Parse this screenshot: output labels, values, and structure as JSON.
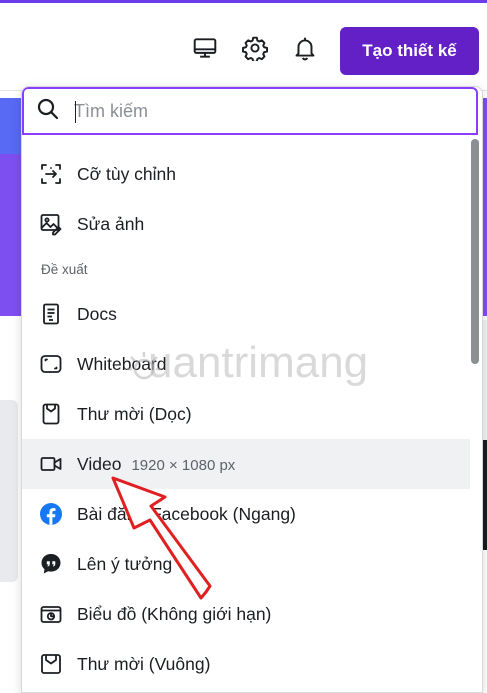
{
  "header": {
    "desktop_icon": "monitor-icon",
    "settings_icon": "gear-icon",
    "notifications_icon": "bell-icon",
    "create_button_label": "Tạo thiết kế",
    "accent_color": "#6420c7"
  },
  "search": {
    "placeholder": "Tìm kiếm",
    "value": "",
    "icon": "search-icon",
    "focus_color": "#8b3dff"
  },
  "menu": {
    "top_items": [
      {
        "label": "Cỡ tùy chỉnh",
        "icon": "custom-size-icon"
      },
      {
        "label": "Sửa ảnh",
        "icon": "image-edit-icon"
      }
    ],
    "section_label": "Đề xuất",
    "suggested_items": [
      {
        "label": "Docs",
        "icon": "docs-icon"
      },
      {
        "label": "Whiteboard",
        "icon": "whiteboard-icon"
      },
      {
        "label": "Thư mời (Dọc)",
        "icon": "invitation-portrait-icon"
      },
      {
        "label": "Video",
        "dimensions": "1920 × 1080 px",
        "icon": "video-camera-icon",
        "highlighted": true
      },
      {
        "label": "Bài đăng Facebook (Ngang)",
        "icon": "facebook-icon"
      },
      {
        "label": "Lên ý tưởng",
        "icon": "quote-bubble-icon"
      },
      {
        "label": "Biểu đồ (Không giới hạn)",
        "icon": "chart-icon"
      },
      {
        "label": "Thư mời (Vuông)",
        "icon": "invitation-square-icon"
      }
    ]
  },
  "watermark": {
    "text": "uantrimang"
  },
  "annotation": {
    "arrow_color": "#e02020"
  }
}
